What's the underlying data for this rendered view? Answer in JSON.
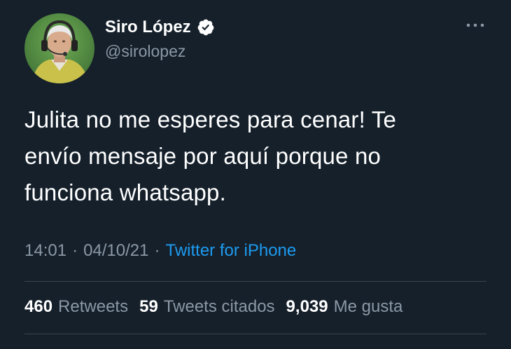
{
  "author": {
    "display_name": "Siro López",
    "handle": "@sirolopez",
    "verified": true,
    "avatar_icon": "profile-photo"
  },
  "tweet": {
    "text": "Julita no me esperes para cenar! Te\nenvío mensaje por aquí porque no\nfunciona whatsapp.",
    "time": "14:01",
    "date": "04/10/21",
    "separator": "·",
    "source": "Twitter for iPhone"
  },
  "stats": {
    "retweets_count": "460",
    "retweets_label": "Retweets",
    "quotes_count": "59",
    "quotes_label": "Tweets citados",
    "likes_count": "9,039",
    "likes_label": "Me gusta"
  },
  "colors": {
    "background": "#15202b",
    "text_primary": "#ffffff",
    "text_secondary": "#8b98a5",
    "accent": "#1d9bf0",
    "divider": "#38444d"
  },
  "icons": {
    "verified": "verified-badge-icon",
    "more": "more-options-icon"
  }
}
